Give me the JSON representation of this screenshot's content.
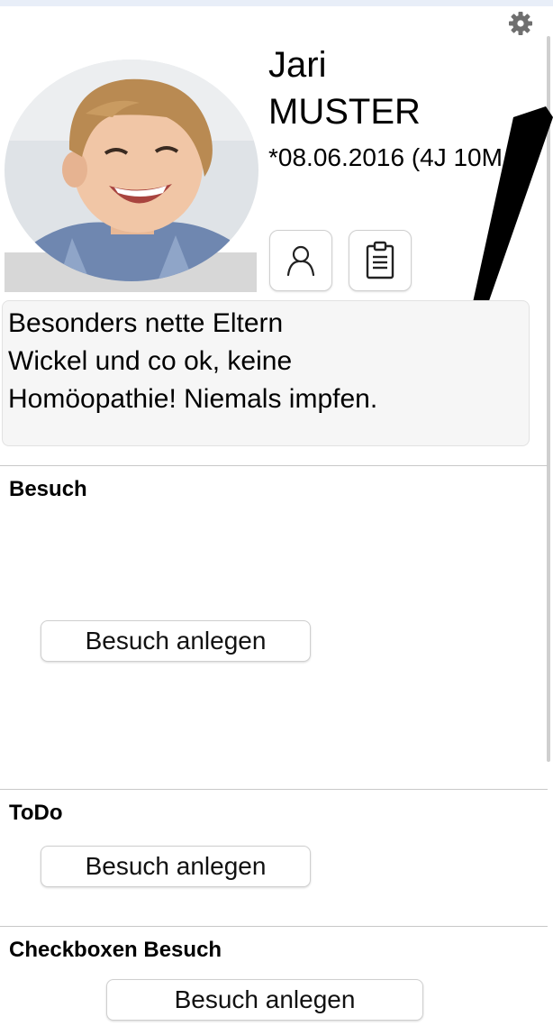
{
  "patient": {
    "first_name": "Jari",
    "last_name": "MUSTER",
    "birth": "*08.06.2016 (4J 10M"
  },
  "note": {
    "lines": [
      "Besonders nette Eltern",
      "Wickel und co ok, keine",
      "Homöopathie! Niemals impfen."
    ]
  },
  "sections": [
    {
      "title": "Besuch",
      "button": "Besuch anlegen"
    },
    {
      "title": "ToDo",
      "button": "Besuch anlegen"
    },
    {
      "title": "Checkboxen Besuch",
      "button": "Besuch anlegen"
    }
  ],
  "icons": {
    "settings": "gear-icon",
    "patient": "person-icon",
    "form": "clipboard-icon",
    "photo": "child-portrait"
  }
}
